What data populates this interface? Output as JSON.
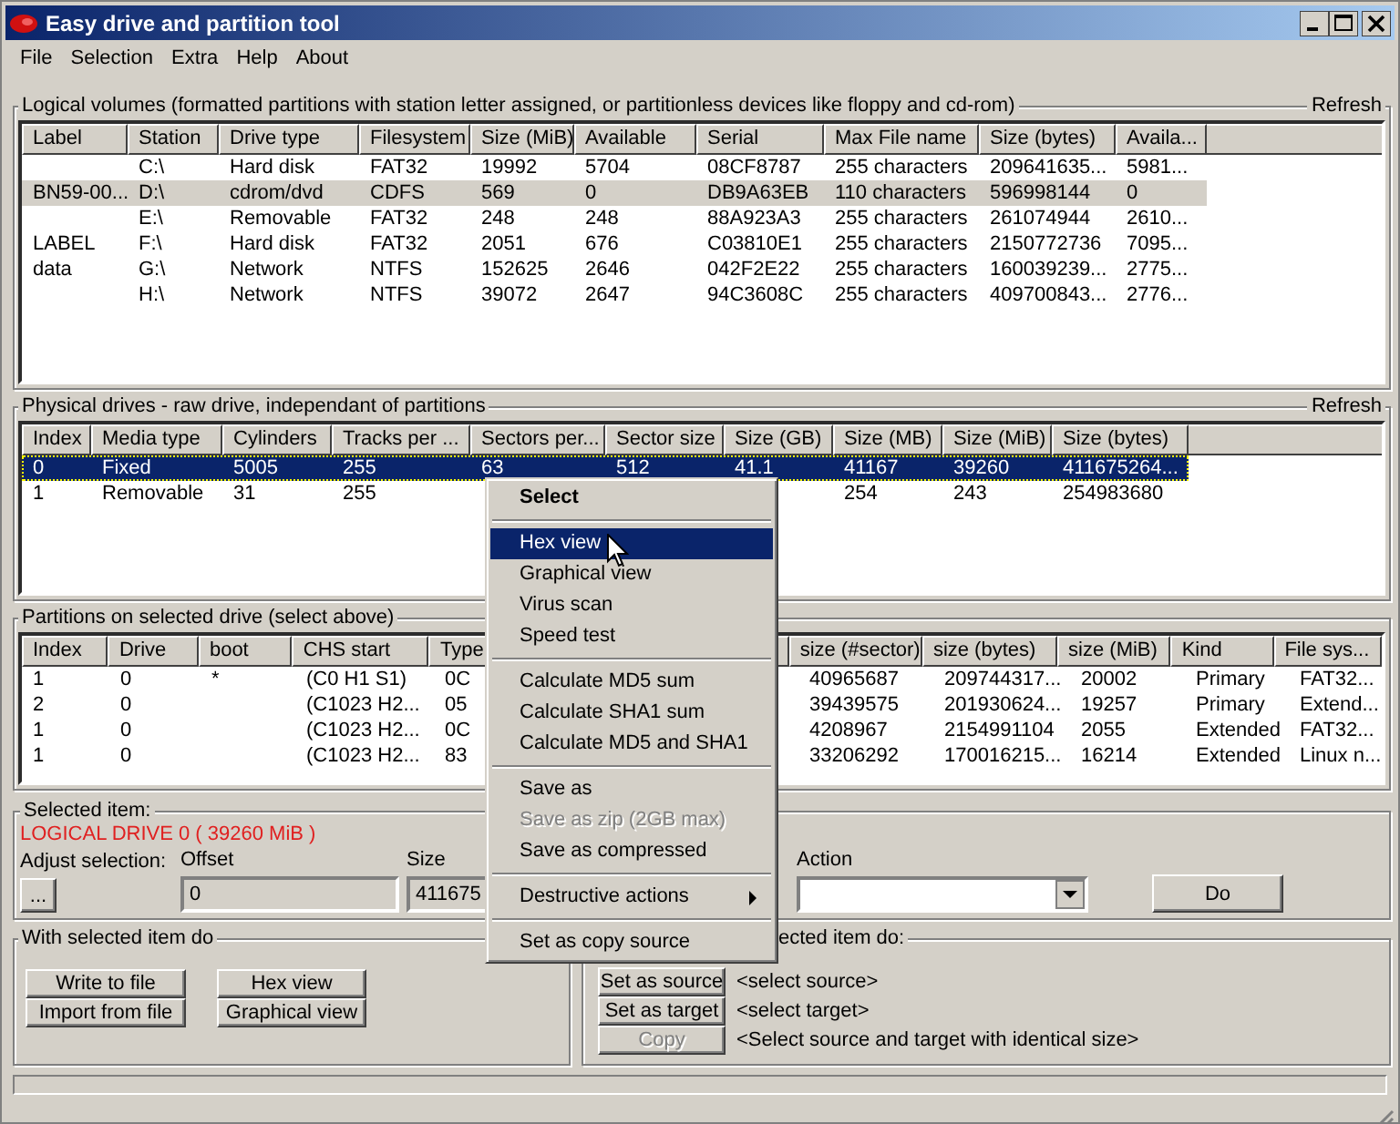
{
  "window": {
    "title": "Easy drive and partition tool"
  },
  "menu_bar": [
    "File",
    "Selection",
    "Extra",
    "Help",
    "About"
  ],
  "logical_volumes": {
    "title": "Logical volumes (formatted partitions with station letter assigned, or partitionless devices like floppy and cd-rom)",
    "refresh": "Refresh",
    "columns": [
      "Label",
      "Station",
      "Drive type",
      "Filesystem",
      "Size (MiB)",
      "Available",
      "Serial",
      "Max File name",
      "Size (bytes)",
      "Availa..."
    ],
    "rows": [
      {
        "selected": false,
        "cells": [
          null,
          "C:\\",
          "Hard disk",
          "FAT32",
          "19992",
          "5704",
          "08CF8787",
          "255 characters",
          "209641635...",
          "5981..."
        ]
      },
      {
        "selected": true,
        "cells": [
          "BN59-00...",
          "D:\\",
          "cdrom/dvd",
          "CDFS",
          "569",
          "0",
          "DB9A63EB",
          "110 characters",
          "596998144",
          "0"
        ]
      },
      {
        "selected": false,
        "cells": [
          null,
          "E:\\",
          "Removable",
          "FAT32",
          "248",
          "248",
          "88A923A3",
          "255 characters",
          "261074944",
          "2610..."
        ]
      },
      {
        "selected": false,
        "cells": [
          "LABEL",
          "F:\\",
          "Hard disk",
          "FAT32",
          "2051",
          "676",
          "C03810E1",
          "255 characters",
          "2150772736",
          "7095..."
        ]
      },
      {
        "selected": false,
        "cells": [
          "data",
          "G:\\",
          "Network",
          "NTFS",
          "152625",
          "2646",
          "042F2E22",
          "255 characters",
          "160039239...",
          "2775..."
        ]
      },
      {
        "selected": false,
        "cells": [
          null,
          "H:\\",
          "Network",
          "NTFS",
          "39072",
          "2647",
          "94C3608C",
          "255 characters",
          "409700843...",
          "2776..."
        ]
      }
    ]
  },
  "physical_drives": {
    "title": "Physical drives - raw drive, independant of partitions",
    "refresh": "Refresh",
    "columns": [
      "Index",
      "Media type",
      "Cylinders",
      "Tracks per ...",
      "Sectors per...",
      "Sector size",
      "Size (GB)",
      "Size (MB)",
      "Size (MiB)",
      "Size (bytes)"
    ],
    "rows": [
      {
        "selected": true,
        "cells": [
          "0",
          "Fixed",
          "5005",
          "255",
          "63",
          "512",
          "41.1",
          "41167",
          "39260",
          "411675264..."
        ]
      },
      {
        "selected": false,
        "cells": [
          "1",
          "Removable",
          "31",
          "255",
          null,
          null,
          null,
          "254",
          "243",
          "254983680"
        ]
      }
    ]
  },
  "partitions": {
    "title": "Partitions on selected drive (select above)",
    "columns": [
      "Index",
      "Drive",
      "boot",
      "CHS start",
      "Type",
      "size (#sector)",
      "size (bytes)",
      "size (MiB)",
      "Kind",
      "File sys..."
    ],
    "rows": [
      {
        "selected": false,
        "cells": [
          "1",
          "0",
          "*",
          "(C0 H1 S1)",
          "0C",
          "40965687",
          "209744317...",
          "20002",
          "Primary",
          "FAT32..."
        ]
      },
      {
        "selected": false,
        "cells": [
          "2",
          "0",
          null,
          "(C1023 H2...",
          "05",
          "39439575",
          "201930624...",
          "19257",
          "Primary",
          "Extend..."
        ]
      },
      {
        "selected": false,
        "cells": [
          "1",
          "0",
          null,
          "(C1023 H2...",
          "0C",
          "4208967",
          "2154991104",
          "2055",
          "Extended",
          "FAT32..."
        ]
      },
      {
        "selected": false,
        "cells": [
          "1",
          "0",
          null,
          "(C1023 H2...",
          "83",
          "33206292",
          "170016215...",
          "16214",
          "Extended",
          "Linux n..."
        ]
      }
    ]
  },
  "selected_item": {
    "title": "Selected item:",
    "value": "LOGICAL DRIVE 0   ( 39260 MiB )",
    "adjust_label": "Adjust selection:",
    "adjust_button": "...",
    "offset_label": "Offset",
    "offset_value": "0",
    "size_label": "Size",
    "size_value": "411675",
    "action_label": "Action",
    "do_button": "Do"
  },
  "with_selected": {
    "title": "With selected item do",
    "buttons": [
      {
        "label": "Write to file"
      },
      {
        "label": "Import from file"
      },
      {
        "label": "Hex view"
      },
      {
        "label": "Graphical view"
      }
    ]
  },
  "copy_group": {
    "title": "ected item do:",
    "rows": [
      {
        "button": "Set as source",
        "disabled": false,
        "status": "<select source>"
      },
      {
        "button": "Set as target",
        "disabled": false,
        "status": "<select target>"
      },
      {
        "button": "Copy",
        "disabled": true,
        "status": "<Select source and target with identical size>"
      }
    ]
  },
  "context_menu": [
    {
      "kind": "header",
      "label": "Select"
    },
    {
      "kind": "separator"
    },
    {
      "kind": "item",
      "label": "Hex view",
      "selected": true,
      "disabled": false
    },
    {
      "kind": "item",
      "label": "Graphical view",
      "selected": false,
      "disabled": false
    },
    {
      "kind": "item",
      "label": "Virus scan",
      "selected": false,
      "disabled": false
    },
    {
      "kind": "item",
      "label": "Speed test",
      "selected": false,
      "disabled": false
    },
    {
      "kind": "separator"
    },
    {
      "kind": "item",
      "label": "Calculate MD5 sum",
      "selected": false,
      "disabled": false
    },
    {
      "kind": "item",
      "label": "Calculate SHA1 sum",
      "selected": false,
      "disabled": false
    },
    {
      "kind": "item",
      "label": "Calculate MD5 and SHA1",
      "selected": false,
      "disabled": false
    },
    {
      "kind": "separator"
    },
    {
      "kind": "item",
      "label": "Save as",
      "selected": false,
      "disabled": false
    },
    {
      "kind": "item",
      "label": "Save as zip (2GB max)",
      "selected": false,
      "disabled": true
    },
    {
      "kind": "item",
      "label": "Save as compressed",
      "selected": false,
      "disabled": false
    },
    {
      "kind": "separator"
    },
    {
      "kind": "submenu",
      "label": "Destructive actions",
      "selected": false,
      "disabled": false
    },
    {
      "kind": "separator"
    },
    {
      "kind": "item",
      "label": "Set as copy source",
      "selected": false,
      "disabled": false
    }
  ],
  "progress": {
    "level": 0
  }
}
